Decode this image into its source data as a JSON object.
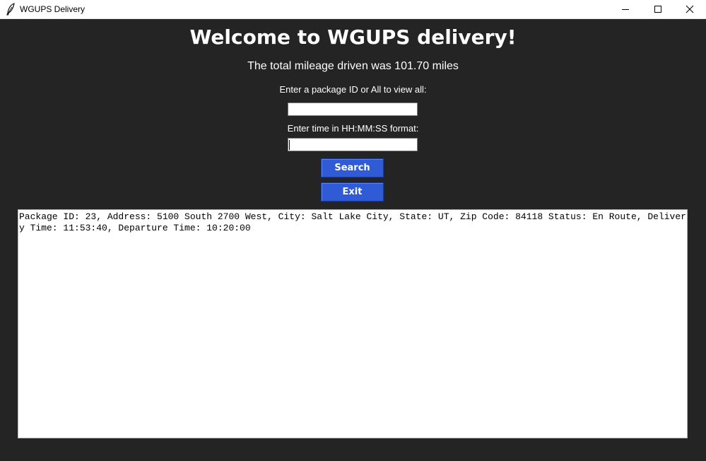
{
  "window": {
    "title": "WGUPS Delivery",
    "icon": "feather-icon"
  },
  "main": {
    "heading": "Welcome to WGUPS delivery!",
    "mileage_text": "The total mileage driven was 101.70 miles",
    "package_label": "Enter a package ID or All to view all:",
    "package_value": "",
    "time_label": "Enter time in HH:MM:SS format:",
    "time_value": "",
    "search_label": "Search",
    "exit_label": "Exit",
    "output_text": "Package ID: 23, Address: 5100 South 2700 West, City: Salt Lake City, State: UT, Zip Code: 84118 Status: En Route, Delivery Time: 11:53:40, Departure Time: 10:20:00"
  },
  "colors": {
    "background": "#242424",
    "button": "#2f5bd6",
    "text": "#ffffff"
  }
}
